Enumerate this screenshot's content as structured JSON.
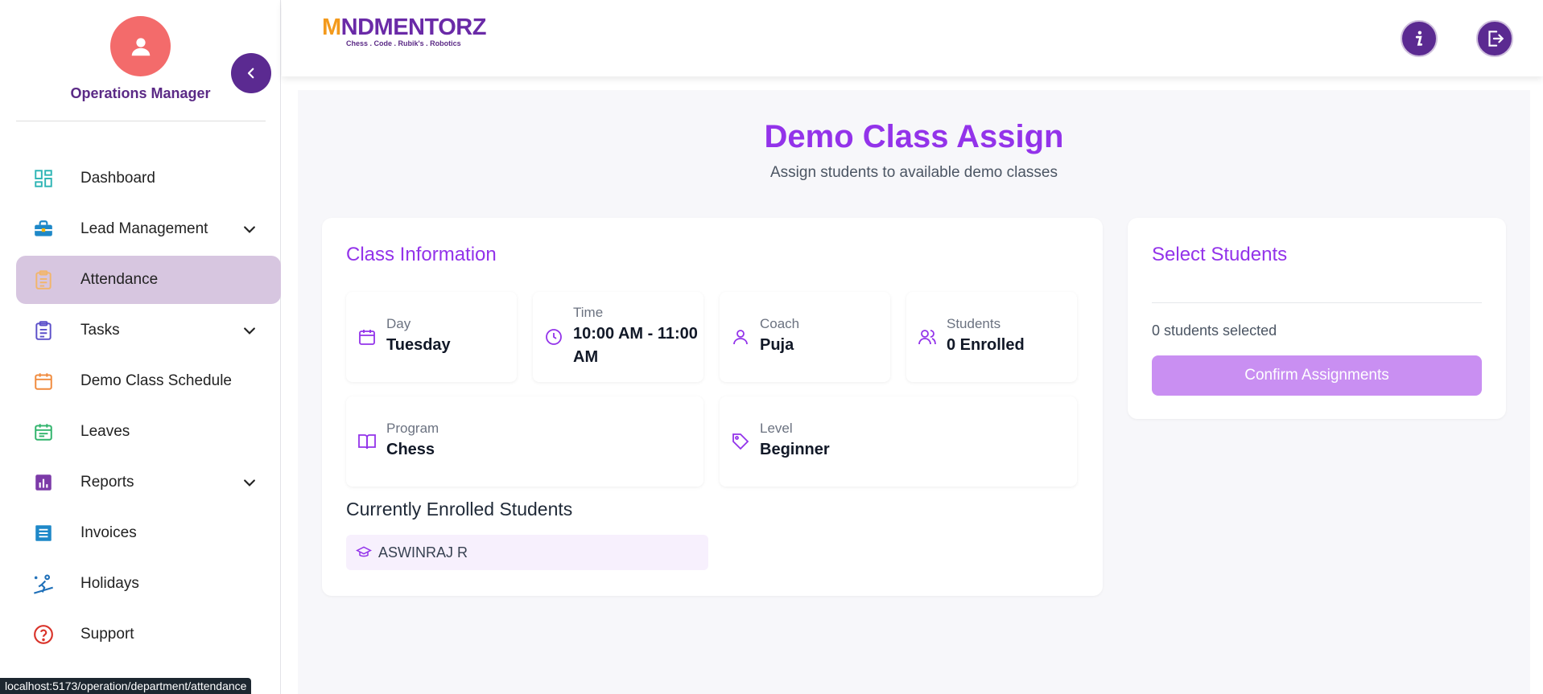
{
  "sidebar": {
    "role": "Operations Manager",
    "items": [
      {
        "label": "Dashboard"
      },
      {
        "label": "Lead Management"
      },
      {
        "label": "Attendance"
      },
      {
        "label": "Tasks"
      },
      {
        "label": "Demo Class Schedule"
      },
      {
        "label": "Leaves"
      },
      {
        "label": "Reports"
      },
      {
        "label": "Invoices"
      },
      {
        "label": "Holidays"
      },
      {
        "label": "Support"
      }
    ],
    "icons": [
      "dashboard-icon",
      "briefcase-icon",
      "clipboard-icon",
      "tasks-icon",
      "calendar-icon",
      "leave-calendar-icon",
      "reports-icon",
      "invoice-icon",
      "holidays-icon",
      "support-icon"
    ]
  },
  "header": {
    "logo_text_a": "M",
    "logo_text_b": "NDMENTOR",
    "logo_sub": "Chess . Code . Rubik's . Robotics"
  },
  "status_url": "localhost:5173/operation/department/attendance",
  "page": {
    "title": "Demo Class Assign",
    "subtitle": "Assign students to available demo classes"
  },
  "class_info": {
    "title": "Class Information",
    "day_label": "Day",
    "day_value": "Tuesday",
    "time_label": "Time",
    "time_value_1": "10:00 AM - 11:00",
    "time_value_2": "AM",
    "coach_label": "Coach",
    "coach_value": "Puja",
    "students_label": "Students",
    "students_value": "0 Enrolled",
    "program_label": "Program",
    "program_value": "Chess",
    "level_label": "Level",
    "level_value": "Beginner",
    "enrolled_title": "Currently Enrolled Students",
    "enrolled": [
      "ASWINRAJ R"
    ]
  },
  "select_students": {
    "title": "Select Students",
    "count_text": "0 students selected",
    "confirm_label": "Confirm Assignments"
  },
  "colors": {
    "accent": "#9333ea",
    "brand_purple": "#5b2a91",
    "active_nav": "#d7c6e0",
    "avatar": "#f36b6b",
    "confirm_disabled": "#c98ff2"
  }
}
